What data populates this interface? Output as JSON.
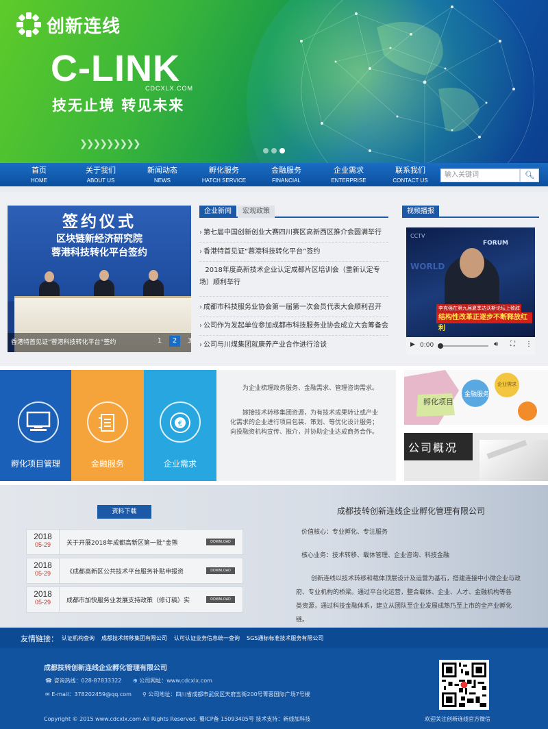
{
  "banner": {
    "brand_cn": "创新连线",
    "brand_en": "C-LINK",
    "domain": "CDCXLX.COM",
    "slogan": "技无止境  转见未来",
    "slides": 3,
    "active_slide": 3
  },
  "nav": {
    "items": [
      {
        "cn": "首页",
        "en": "HOME"
      },
      {
        "cn": "关于我们",
        "en": "ABOUT US"
      },
      {
        "cn": "新闻动态",
        "en": "NEWS"
      },
      {
        "cn": "孵化服务",
        "en": "HATCH SERVICE"
      },
      {
        "cn": "金融服务",
        "en": "FINANCIAL"
      },
      {
        "cn": "企业需求",
        "en": "ENTERPRISE"
      },
      {
        "cn": "联系我们",
        "en": "CONTACT US"
      }
    ],
    "search_placeholder": "输入关键词"
  },
  "news": {
    "photo": {
      "line1": "签约仪式",
      "line2": "区块链新经济研究院",
      "line3": "蓉港科技转化平台签约",
      "caption": "香港特首见证“蓉港科技转化平台”签约",
      "pages": [
        "1",
        "2",
        "3"
      ],
      "active_page": "2"
    },
    "tabs": [
      "企业新闻",
      "宏观政策"
    ],
    "items": [
      "第七届中国创新创业大赛四川赛区高新西区推介会圆满举行",
      "香港特首见证“蓉港科技转化平台”签约",
      "2018年度高新技术企业认定成都片区培训会（重新认定专场）顺利举行",
      "成都市科技服务业协会第一届第一次会员代表大会顺利召开",
      "公司作为发起单位参加成都市科技服务业协会成立大会筹备会",
      "公司与川煤集团就康养产业合作进行洽谈"
    ]
  },
  "video": {
    "tab": "视频播报",
    "time": "0:00",
    "banner1": "李克强在第九届夏季达沃斯论坛上致辞",
    "banner2": "结构性改革正逐步不断释放红利"
  },
  "services": {
    "items": [
      {
        "label": "孵化项目管理",
        "color": "#1a5fb8"
      },
      {
        "label": "金融服务",
        "color": "#f5a43c"
      },
      {
        "label": "企业需求",
        "color": "#27a6df"
      }
    ],
    "desc": [
      "为企业梳理政务服务、金融需求、管理咨询需求。",
      "嫁接技术转移集团资源，为有技术成果转让或产业化需求的企业进行项目包装、策划、等优化设计服务；向投融资机构宣传、推介，并协助企业达成商务合作。"
    ],
    "puzzle": {
      "a": "孵化项目",
      "b": "金融服务",
      "c": "企业需求"
    },
    "overview": "公司概况"
  },
  "downloads": {
    "title": "资料下载",
    "button": "DOWNLOAD",
    "items": [
      {
        "year": "2018",
        "date": "05-29",
        "title": "关于开展2018年成都高新区第一批“金熊"
      },
      {
        "year": "2018",
        "date": "05-29",
        "title": "《成都高新区公共技术平台服务补贴申报资"
      },
      {
        "year": "2018",
        "date": "05-29",
        "title": "成都市加快服务业发展支持政策（修订稿）实"
      }
    ]
  },
  "company": {
    "name": "成都技转创新连线企业孵化管理有限公司",
    "values": "价值核心：专业孵化、专注服务",
    "business": "核心业务：技术转移、载体管理、企业咨询、科技金融",
    "intro_1": "创新连线以技术转移和载体顶层设计及运营为基石，搭建连接中小微企业与政",
    "intro_2": "府、专业机构的桥梁。通过平台化运营，整合载体、企业、人才、金融机构等各",
    "intro_3": "类资源，通过科技金融体系，建立从团队至企业发展成熟乃至上市的全产业孵化",
    "intro_4": "链。"
  },
  "footer": {
    "links_heading": "友情链接：",
    "links": [
      "认证机构查询",
      "成都技术转移集团有限公司",
      "认可认证业务信息统一查询",
      "SGS通标标准技术服务有限公司"
    ],
    "company": "成都技转创新连线企业孵化管理有限公司",
    "hotline": "咨询热线：028-87833322",
    "website": "公司网址：www.cdcxlx.com",
    "email": "E-mail：378202459@qq.com",
    "address": "公司地址：四川省成都市武侯区天府五街200号菁蓉国际广场7号楼",
    "copyright": "Copyright © 2015   www.cdcxlx.com   All Rights Reserved.   蜀ICP备 15093405号   技术支持：新线加科技",
    "qr_caption": "欢迎关注创新连线官方微信"
  }
}
